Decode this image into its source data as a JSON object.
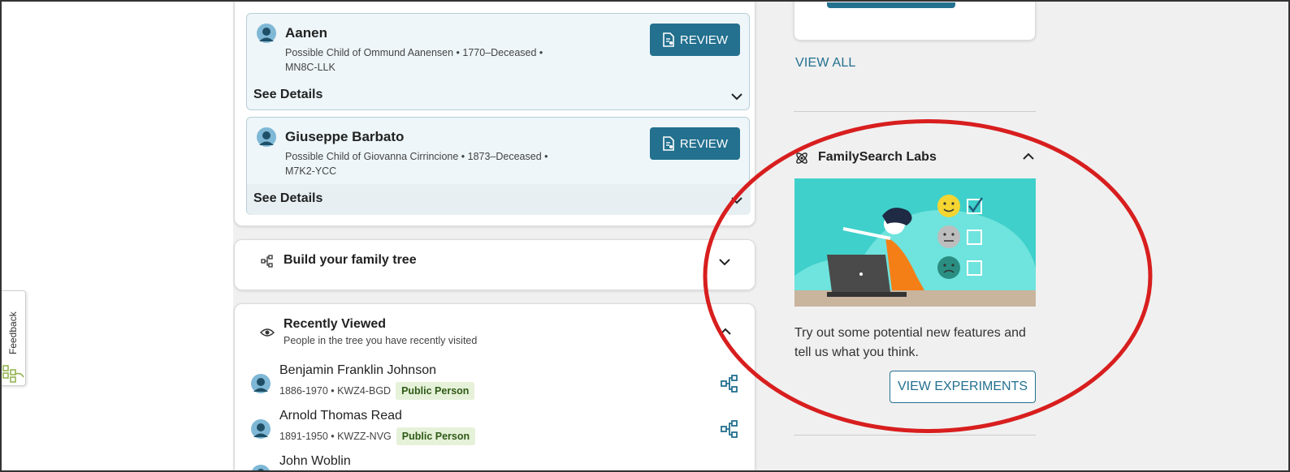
{
  "feedback": {
    "label": "Feedback"
  },
  "tasks": [
    {
      "name": "Aanen",
      "desc_line1": "Possible Child of Ommund Aanensen • 1770–Deceased •",
      "desc_line2": "MN8C-LLK",
      "review_label": "REVIEW",
      "details_label": "See Details"
    },
    {
      "name": "Giuseppe Barbato",
      "desc_line1": "Possible Child of Giovanna Cirrincione • 1873–Deceased •",
      "desc_line2": "M7K2-YCC",
      "review_label": "REVIEW",
      "details_label": "See Details"
    }
  ],
  "build_tree": {
    "title": "Build your family tree"
  },
  "recently_viewed": {
    "title": "Recently Viewed",
    "subtitle": "People in the tree you have recently visited",
    "people": [
      {
        "name": "Benjamin Franklin Johnson",
        "meta": "1886-1970 • KWZ4-BGD",
        "badge": "Public Person"
      },
      {
        "name": "Arnold Thomas Read",
        "meta": "1891-1950 • KWZZ-NVG",
        "badge": "Public Person"
      },
      {
        "name": "John Woblin"
      }
    ]
  },
  "right": {
    "view_all": "VIEW ALL",
    "labs": {
      "title": "FamilySearch Labs",
      "description": "Try out some potential new features and tell us what you think.",
      "button": "VIEW EXPERIMENTS"
    }
  },
  "colors": {
    "accent": "#23708f",
    "annotation": "#d81e1e",
    "badge_bg": "#e6f1d9",
    "task_bg": "#eef6f9"
  }
}
